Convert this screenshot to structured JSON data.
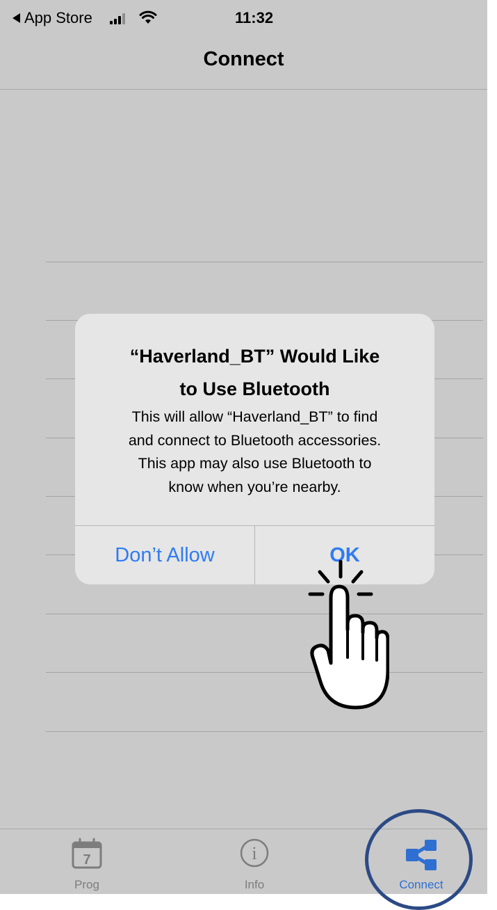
{
  "status_bar": {
    "back_app_label": "App Store",
    "time": "11:32",
    "signal_icon": "cellular-signal-icon",
    "wifi_icon": "wifi-icon"
  },
  "nav": {
    "title": "Connect"
  },
  "alert": {
    "title_line1": "“Haverland_BT” Would Like",
    "title_line2": "to Use Bluetooth",
    "message_line1": "This will allow “Haverland_BT” to find",
    "message_line2": "and connect to Bluetooth accessories.",
    "message_line3": "This app may also use Bluetooth to",
    "message_line4": "know when you’re nearby.",
    "deny_label": "Don’t Allow",
    "ok_label": "OK"
  },
  "tabs": [
    {
      "label": "Prog",
      "icon": "calendar-icon",
      "icon_text": "7",
      "active": false
    },
    {
      "label": "Info",
      "icon": "info-icon",
      "icon_text": "i",
      "active": false
    },
    {
      "label": "Connect",
      "icon": "share-network-icon",
      "active": true
    }
  ],
  "colors": {
    "accent": "#2f7bf4",
    "tab_active": "#2f6fd1",
    "highlight_ring": "#2c4a85",
    "background": "#c9c9c9",
    "alert_background": "#e6e6e6"
  },
  "overlay": {
    "pointer_icon": "tap-hand-icon",
    "highlight_icon": "highlight-circle"
  }
}
